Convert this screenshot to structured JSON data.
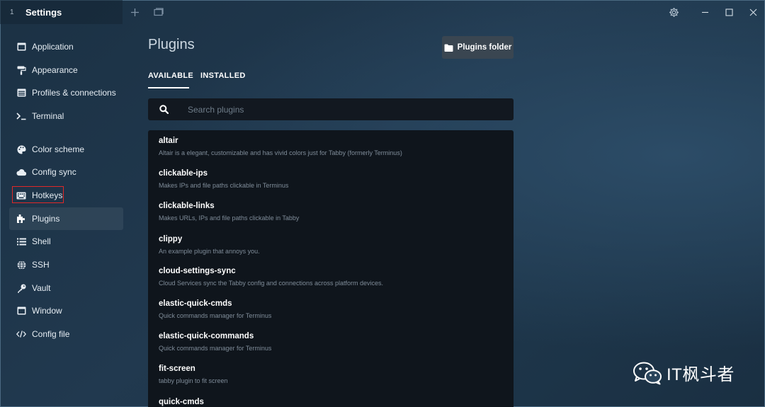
{
  "window": {
    "tab_index": "1",
    "tab_title": "Settings"
  },
  "sidebar": {
    "items": [
      {
        "label": "Application",
        "icon": "window-icon"
      },
      {
        "label": "Appearance",
        "icon": "paint-roller-icon"
      },
      {
        "label": "Profiles & connections",
        "icon": "window-list-icon"
      },
      {
        "label": "Terminal",
        "icon": "terminal-icon"
      },
      {
        "label": "Color scheme",
        "icon": "palette-icon"
      },
      {
        "label": "Config sync",
        "icon": "cloud-icon"
      },
      {
        "label": "Hotkeys",
        "icon": "keyboard-icon"
      },
      {
        "label": "Plugins",
        "icon": "puzzle-icon",
        "active": true
      },
      {
        "label": "Shell",
        "icon": "list-icon"
      },
      {
        "label": "SSH",
        "icon": "globe-icon"
      },
      {
        "label": "Vault",
        "icon": "key-icon"
      },
      {
        "label": "Window",
        "icon": "window-icon"
      },
      {
        "label": "Config file",
        "icon": "code-icon"
      }
    ]
  },
  "main": {
    "title": "Plugins",
    "folder_button": "Plugins folder",
    "tabs": [
      {
        "label": "AVAILABLE",
        "active": true
      },
      {
        "label": "INSTALLED",
        "active": false
      }
    ],
    "search": {
      "placeholder": "Search plugins",
      "value": ""
    },
    "plugins": [
      {
        "name": "altair",
        "description": "Altair is a elegant, customizable and has vivid colors just for Tabby (formerly Terminus)"
      },
      {
        "name": "clickable-ips",
        "description": "Makes IPs and file paths clickable in Terminus"
      },
      {
        "name": "clickable-links",
        "description": "Makes URLs, IPs and file paths clickable in Tabby"
      },
      {
        "name": "clippy",
        "description": "An example plugin that annoys you."
      },
      {
        "name": "cloud-settings-sync",
        "description": "Cloud Services sync the Tabby config and connections across platform devices."
      },
      {
        "name": "elastic-quick-cmds",
        "description": "Quick commands manager for Terminus"
      },
      {
        "name": "elastic-quick-commands",
        "description": "Quick commands manager for Terminus"
      },
      {
        "name": "fit-screen",
        "description": "tabby plugin to fit screen"
      },
      {
        "name": "quick-cmds",
        "description": ""
      }
    ]
  },
  "watermark": {
    "text": "IT枫斗者"
  },
  "colors": {
    "background": "#1d3549",
    "panel": "#0f151c",
    "highlight": "#e02828",
    "button": "#3a4651"
  }
}
